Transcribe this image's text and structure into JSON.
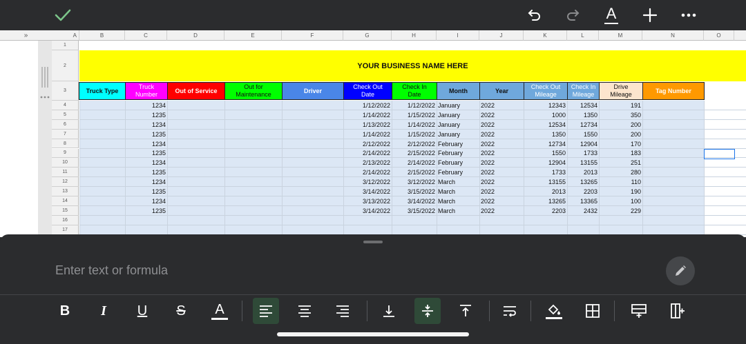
{
  "toolbar_top": {
    "done": "check-icon",
    "undo": "undo-icon",
    "redo": "redo-icon",
    "text_format": "A",
    "insert": "plus-icon",
    "more": "more-icon"
  },
  "sheet": {
    "collapse_label": "»",
    "columns": [
      "A",
      "B",
      "C",
      "D",
      "E",
      "F",
      "G",
      "H",
      "I",
      "J",
      "K",
      "L",
      "M",
      "N",
      "O"
    ],
    "rows": [
      "1",
      "2",
      "3",
      "4",
      "5",
      "6",
      "7",
      "8",
      "9",
      "10",
      "11",
      "12",
      "13",
      "14",
      "15",
      "16",
      "17"
    ],
    "title": "YOUR BUSINESS NAME HERE",
    "headers": [
      {
        "line1": "Truck Type",
        "line2": "",
        "bg": "#00ffff",
        "color": "#111111"
      },
      {
        "line1": "Truck",
        "line2": "Number",
        "bg": "#ff00ff",
        "color": "#ffffff"
      },
      {
        "line1": "Out of Service",
        "line2": "",
        "bg": "#ff0000",
        "color": "#ffffff"
      },
      {
        "line1": "Out for",
        "line2": "Maintenance",
        "bg": "#00ff00",
        "color": "#111111"
      },
      {
        "line1": "Driver",
        "line2": "",
        "bg": "#4a86e8",
        "color": "#ffffff"
      },
      {
        "line1": "Check Out",
        "line2": "Date",
        "bg": "#0000ff",
        "color": "#ffffff"
      },
      {
        "line1": "Check In",
        "line2": "Date",
        "bg": "#00ff00",
        "color": "#111111"
      },
      {
        "line1": "Month",
        "line2": "",
        "bg": "#6fa8dc",
        "color": "#111111"
      },
      {
        "line1": "Year",
        "line2": "",
        "bg": "#6fa8dc",
        "color": "#111111"
      },
      {
        "line1": "Check Out",
        "line2": "Mileage",
        "bg": "#6fa8dc",
        "color": "#ffffff"
      },
      {
        "line1": "Check In",
        "line2": "Mileage",
        "bg": "#6fa8dc",
        "color": "#ffffff"
      },
      {
        "line1": "Drive",
        "line2": "Mileage",
        "bg": "#fce5cd",
        "color": "#111111"
      },
      {
        "line1": "Tag Number",
        "line2": "",
        "bg": "#ff9900",
        "color": "#ffffff"
      }
    ],
    "data": [
      [
        "1234",
        "1/12/2022",
        "1/12/2022",
        "January",
        "2022",
        "12343",
        "12534",
        "191"
      ],
      [
        "1235",
        "1/14/2022",
        "1/15/2022",
        "January",
        "2022",
        "1000",
        "1350",
        "350"
      ],
      [
        "1234",
        "1/13/2022",
        "1/14/2022",
        "January",
        "2022",
        "12534",
        "12734",
        "200"
      ],
      [
        "1235",
        "1/14/2022",
        "1/15/2022",
        "January",
        "2022",
        "1350",
        "1550",
        "200"
      ],
      [
        "1234",
        "2/12/2022",
        "2/12/2022",
        "February",
        "2022",
        "12734",
        "12904",
        "170"
      ],
      [
        "1235",
        "2/14/2022",
        "2/15/2022",
        "February",
        "2022",
        "1550",
        "1733",
        "183"
      ],
      [
        "1234",
        "2/13/2022",
        "2/14/2022",
        "February",
        "2022",
        "12904",
        "13155",
        "251"
      ],
      [
        "1235",
        "2/14/2022",
        "2/15/2022",
        "February",
        "2022",
        "1733",
        "2013",
        "280"
      ],
      [
        "1234",
        "3/12/2022",
        "3/12/2022",
        "March",
        "2022",
        "13155",
        "13265",
        "110"
      ],
      [
        "1235",
        "3/14/2022",
        "3/15/2022",
        "March",
        "2022",
        "2013",
        "2203",
        "190"
      ],
      [
        "1234",
        "3/13/2022",
        "3/14/2022",
        "March",
        "2022",
        "13265",
        "13365",
        "100"
      ],
      [
        "1235",
        "3/14/2022",
        "3/15/2022",
        "March",
        "2022",
        "2203",
        "2432",
        "229"
      ]
    ],
    "colors": {
      "title_bg": "#ffff00",
      "data_bg": "#dce7f5",
      "selection": "#1a73e8"
    }
  },
  "editor": {
    "placeholder": "Enter text or formula",
    "edit_icon": "pencil-icon"
  },
  "format_bar": [
    {
      "name": "bold-button",
      "glyph": "B"
    },
    {
      "name": "italic-button",
      "glyph": "I"
    },
    {
      "name": "underline-button",
      "glyph": "U"
    },
    {
      "name": "strikethrough-button",
      "glyph": "S"
    },
    {
      "name": "text-color-button",
      "glyph": "A"
    }
  ]
}
